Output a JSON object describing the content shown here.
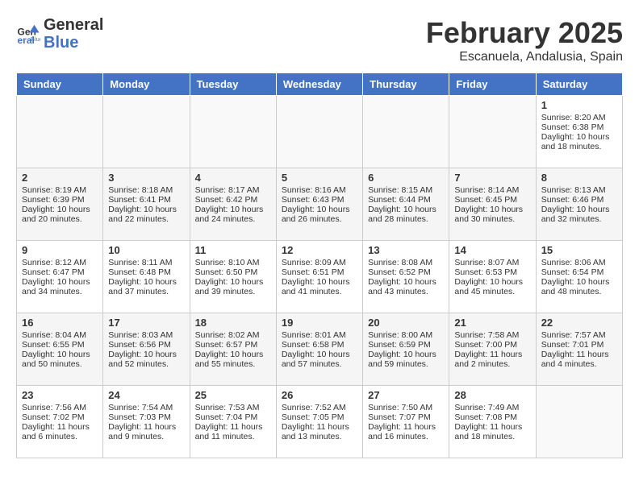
{
  "header": {
    "logo_general": "General",
    "logo_blue": "Blue",
    "month_year": "February 2025",
    "location": "Escanuela, Andalusia, Spain"
  },
  "days_of_week": [
    "Sunday",
    "Monday",
    "Tuesday",
    "Wednesday",
    "Thursday",
    "Friday",
    "Saturday"
  ],
  "weeks": [
    {
      "cells": [
        {
          "empty": true
        },
        {
          "empty": true
        },
        {
          "empty": true
        },
        {
          "empty": true
        },
        {
          "empty": true
        },
        {
          "empty": true
        },
        {
          "day": 1,
          "sunrise": "Sunrise: 8:20 AM",
          "sunset": "Sunset: 6:38 PM",
          "daylight": "Daylight: 10 hours and 18 minutes."
        }
      ]
    },
    {
      "cells": [
        {
          "day": 2,
          "sunrise": "Sunrise: 8:19 AM",
          "sunset": "Sunset: 6:39 PM",
          "daylight": "Daylight: 10 hours and 20 minutes."
        },
        {
          "day": 3,
          "sunrise": "Sunrise: 8:18 AM",
          "sunset": "Sunset: 6:41 PM",
          "daylight": "Daylight: 10 hours and 22 minutes."
        },
        {
          "day": 4,
          "sunrise": "Sunrise: 8:17 AM",
          "sunset": "Sunset: 6:42 PM",
          "daylight": "Daylight: 10 hours and 24 minutes."
        },
        {
          "day": 5,
          "sunrise": "Sunrise: 8:16 AM",
          "sunset": "Sunset: 6:43 PM",
          "daylight": "Daylight: 10 hours and 26 minutes."
        },
        {
          "day": 6,
          "sunrise": "Sunrise: 8:15 AM",
          "sunset": "Sunset: 6:44 PM",
          "daylight": "Daylight: 10 hours and 28 minutes."
        },
        {
          "day": 7,
          "sunrise": "Sunrise: 8:14 AM",
          "sunset": "Sunset: 6:45 PM",
          "daylight": "Daylight: 10 hours and 30 minutes."
        },
        {
          "day": 8,
          "sunrise": "Sunrise: 8:13 AM",
          "sunset": "Sunset: 6:46 PM",
          "daylight": "Daylight: 10 hours and 32 minutes."
        }
      ]
    },
    {
      "cells": [
        {
          "day": 9,
          "sunrise": "Sunrise: 8:12 AM",
          "sunset": "Sunset: 6:47 PM",
          "daylight": "Daylight: 10 hours and 34 minutes."
        },
        {
          "day": 10,
          "sunrise": "Sunrise: 8:11 AM",
          "sunset": "Sunset: 6:48 PM",
          "daylight": "Daylight: 10 hours and 37 minutes."
        },
        {
          "day": 11,
          "sunrise": "Sunrise: 8:10 AM",
          "sunset": "Sunset: 6:50 PM",
          "daylight": "Daylight: 10 hours and 39 minutes."
        },
        {
          "day": 12,
          "sunrise": "Sunrise: 8:09 AM",
          "sunset": "Sunset: 6:51 PM",
          "daylight": "Daylight: 10 hours and 41 minutes."
        },
        {
          "day": 13,
          "sunrise": "Sunrise: 8:08 AM",
          "sunset": "Sunset: 6:52 PM",
          "daylight": "Daylight: 10 hours and 43 minutes."
        },
        {
          "day": 14,
          "sunrise": "Sunrise: 8:07 AM",
          "sunset": "Sunset: 6:53 PM",
          "daylight": "Daylight: 10 hours and 45 minutes."
        },
        {
          "day": 15,
          "sunrise": "Sunrise: 8:06 AM",
          "sunset": "Sunset: 6:54 PM",
          "daylight": "Daylight: 10 hours and 48 minutes."
        }
      ]
    },
    {
      "cells": [
        {
          "day": 16,
          "sunrise": "Sunrise: 8:04 AM",
          "sunset": "Sunset: 6:55 PM",
          "daylight": "Daylight: 10 hours and 50 minutes."
        },
        {
          "day": 17,
          "sunrise": "Sunrise: 8:03 AM",
          "sunset": "Sunset: 6:56 PM",
          "daylight": "Daylight: 10 hours and 52 minutes."
        },
        {
          "day": 18,
          "sunrise": "Sunrise: 8:02 AM",
          "sunset": "Sunset: 6:57 PM",
          "daylight": "Daylight: 10 hours and 55 minutes."
        },
        {
          "day": 19,
          "sunrise": "Sunrise: 8:01 AM",
          "sunset": "Sunset: 6:58 PM",
          "daylight": "Daylight: 10 hours and 57 minutes."
        },
        {
          "day": 20,
          "sunrise": "Sunrise: 8:00 AM",
          "sunset": "Sunset: 6:59 PM",
          "daylight": "Daylight: 10 hours and 59 minutes."
        },
        {
          "day": 21,
          "sunrise": "Sunrise: 7:58 AM",
          "sunset": "Sunset: 7:00 PM",
          "daylight": "Daylight: 11 hours and 2 minutes."
        },
        {
          "day": 22,
          "sunrise": "Sunrise: 7:57 AM",
          "sunset": "Sunset: 7:01 PM",
          "daylight": "Daylight: 11 hours and 4 minutes."
        }
      ]
    },
    {
      "cells": [
        {
          "day": 23,
          "sunrise": "Sunrise: 7:56 AM",
          "sunset": "Sunset: 7:02 PM",
          "daylight": "Daylight: 11 hours and 6 minutes."
        },
        {
          "day": 24,
          "sunrise": "Sunrise: 7:54 AM",
          "sunset": "Sunset: 7:03 PM",
          "daylight": "Daylight: 11 hours and 9 minutes."
        },
        {
          "day": 25,
          "sunrise": "Sunrise: 7:53 AM",
          "sunset": "Sunset: 7:04 PM",
          "daylight": "Daylight: 11 hours and 11 minutes."
        },
        {
          "day": 26,
          "sunrise": "Sunrise: 7:52 AM",
          "sunset": "Sunset: 7:05 PM",
          "daylight": "Daylight: 11 hours and 13 minutes."
        },
        {
          "day": 27,
          "sunrise": "Sunrise: 7:50 AM",
          "sunset": "Sunset: 7:07 PM",
          "daylight": "Daylight: 11 hours and 16 minutes."
        },
        {
          "day": 28,
          "sunrise": "Sunrise: 7:49 AM",
          "sunset": "Sunset: 7:08 PM",
          "daylight": "Daylight: 11 hours and 18 minutes."
        },
        {
          "empty": true
        }
      ]
    }
  ]
}
